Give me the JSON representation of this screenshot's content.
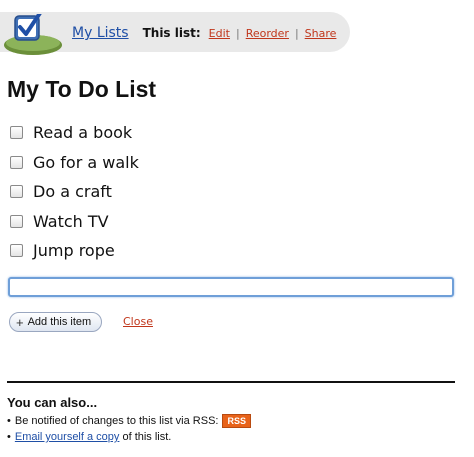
{
  "nav": {
    "logo_icon": "checkmark-logo-icon",
    "my_lists": "My Lists",
    "this_list_label": "This list:",
    "edit": "Edit",
    "separator": "|",
    "reorder": "Reorder",
    "share": "Share"
  },
  "page_title": "My To Do List",
  "items": [
    {
      "label": "Read a book",
      "checked": false
    },
    {
      "label": "Go for a walk",
      "checked": false
    },
    {
      "label": "Do a craft",
      "checked": false
    },
    {
      "label": "Watch TV",
      "checked": false
    },
    {
      "label": "Jump rope",
      "checked": false
    }
  ],
  "new_item": {
    "value": "",
    "add_label": "Add this item",
    "close_label": "Close"
  },
  "also": {
    "title": "You can also...",
    "rss_text": "Be notified of changes to this list via RSS:",
    "rss_badge": "RSS",
    "email_link": "Email yourself a copy",
    "email_suffix": " of this list."
  },
  "colors": {
    "link": "#1f4fa6",
    "action_link": "#c0361b",
    "rss": "#e8631a",
    "input_focus": "#6f9fd8"
  }
}
